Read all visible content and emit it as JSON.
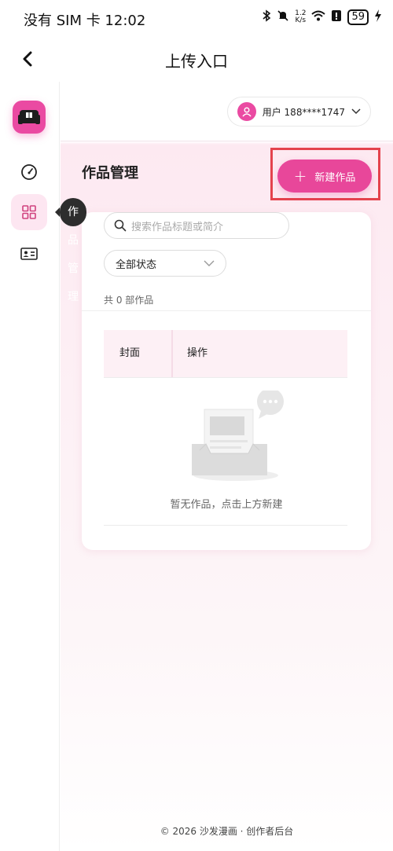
{
  "status_bar": {
    "carrier_time": "没有 SIM 卡 12:02",
    "speed_value": "1.2",
    "speed_unit": "K/s",
    "battery": "59"
  },
  "nav": {
    "title": "上传入口",
    "back_icon": "chevron-left-icon"
  },
  "sidebar": {
    "logo_icon": "sofa-logo-icon",
    "items": [
      {
        "icon": "dashboard-icon",
        "active": false
      },
      {
        "icon": "grid-icon",
        "active": true,
        "tooltip": "作品管理"
      },
      {
        "icon": "id-card-icon",
        "active": false
      }
    ]
  },
  "header": {
    "user_label": "用户 188****1747"
  },
  "main": {
    "page_title": "作品管理",
    "new_button_label": "新建作品",
    "search_placeholder": "搜索作品标题或简介",
    "status_filter": "全部状态",
    "count_text": "共 0 部作品",
    "table_headers": [
      "封面",
      "操作"
    ],
    "empty_text": "暂无作品，点击上方新建"
  },
  "footer": {
    "text": "© 2026 沙发漫画 · 创作者后台"
  },
  "colors": {
    "accent": "#e8479a",
    "highlight_frame": "#e4434d",
    "active_bg": "#fde6f1"
  }
}
